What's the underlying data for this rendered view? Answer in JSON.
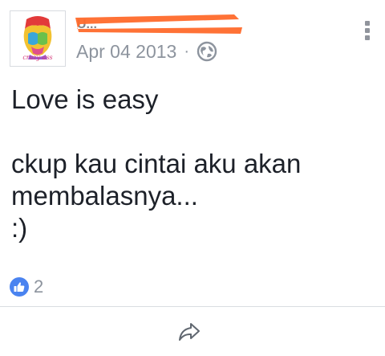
{
  "post": {
    "author": {
      "name": "U...",
      "avatar_caption": "crazy ass"
    },
    "timestamp": "Apr 04 2013",
    "separator": "·",
    "privacy_icon": "globe-icon",
    "more_icon": "more-vertical-icon",
    "message_lines": [
      "Love is easy",
      "",
      "ckup kau cintai aku akan",
      "membalasnya...",
      ":)"
    ],
    "reactions": {
      "icon": "like-thumb-icon",
      "count": "2"
    },
    "actions": {
      "share_icon": "share-arrow-icon"
    }
  },
  "colors": {
    "redaction": "#ff6a2b",
    "text": "#1d2129",
    "meta": "#8d949e",
    "like": "#4a83f0"
  }
}
